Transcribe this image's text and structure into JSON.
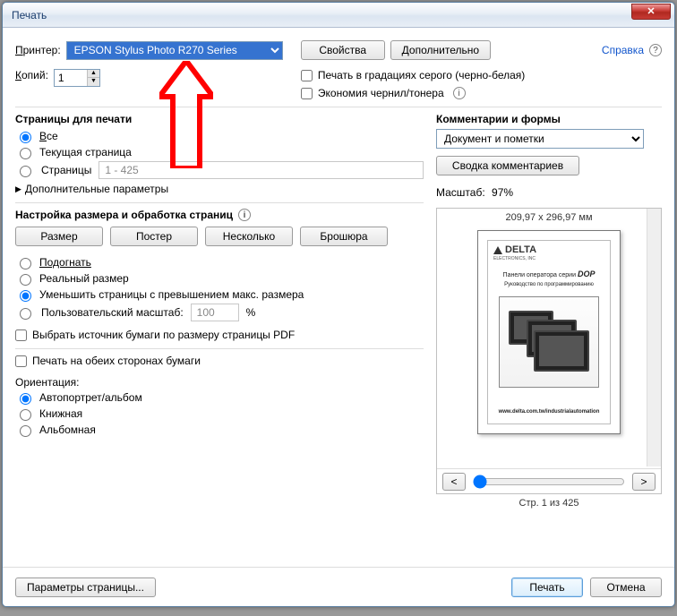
{
  "window": {
    "title": "Печать"
  },
  "header": {
    "printer_label": "Принтер:",
    "printer_selected": "EPSON Stylus Photo R270 Series",
    "properties_btn": "Свойства",
    "advanced_btn": "Дополнительно",
    "help_link": "Справка",
    "copies_label": "Копий:",
    "copies_value": "1",
    "grayscale_cb": "Печать в градациях серого (черно-белая)",
    "eco_cb": "Экономия чернил/тонера"
  },
  "pages_panel": {
    "title": "Страницы для печати",
    "all": "Все",
    "current": "Текущая страница",
    "range_lbl": "Страницы",
    "range_value": "1 - 425",
    "more": "Дополнительные параметры"
  },
  "size_panel": {
    "title": "Настройка размера и обработка страниц",
    "size_btn": "Размер",
    "poster_btn": "Постер",
    "multiple_btn": "Несколько",
    "booklet_btn": "Брошюра",
    "fit": "Подогнать",
    "actual": "Реальный размер",
    "shrink": "Уменьшить страницы с превышением макс. размера",
    "custom": "Пользовательский масштаб:",
    "custom_val": "100",
    "pct": "%",
    "paper_source_cb": "Выбрать источник бумаги по размеру страницы PDF",
    "duplex_cb": "Печать на обеих сторонах бумаги",
    "orientation_lbl": "Ориентация:",
    "orient_auto": "Автопортрет/альбом",
    "orient_portrait": "Книжная",
    "orient_landscape": "Альбомная"
  },
  "comments_panel": {
    "title": "Комментарии и формы",
    "dropdown": "Документ и пометки",
    "summary_btn": "Сводка комментариев",
    "scale_lbl": "Масштаб:",
    "scale_val": "97%",
    "dims": "209,97 x 296,97 мм",
    "preview_brand": "DELTA",
    "preview_brand_sub": "ELECTRONICS, INC",
    "preview_title_pre": "Панели оператора серии",
    "preview_title_brand": "DOP",
    "preview_subtitle": "Руководство по программированию",
    "preview_url": "www.delta.com.tw/industrialautomation",
    "prev": "<",
    "next": ">",
    "status": "Стр. 1 из 425"
  },
  "footer": {
    "page_setup": "Параметры страницы...",
    "print": "Печать",
    "cancel": "Отмена"
  }
}
